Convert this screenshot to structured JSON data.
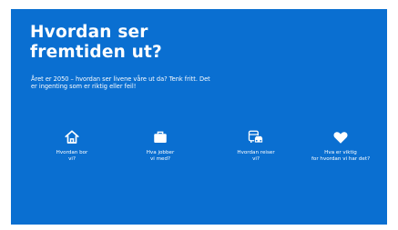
{
  "page": {
    "title_line1": "Hvordan ser",
    "title_line2": "fremtiden ut?",
    "intro": "Året er 2050 – hvordan ser livene våre ut da? Tenk fritt. Det er ingenting som er riktig eller feil!"
  },
  "options": [
    {
      "icon": "home-icon",
      "label": "Hvordan bor\nvi?"
    },
    {
      "icon": "briefcase-icon",
      "label": "Hva jobber\nvi med?"
    },
    {
      "icon": "vehicles-icon",
      "label": "Hvordan reiser\nvi?"
    },
    {
      "icon": "heart-icon",
      "label": "Hva er viktig\nfor hvordan vi har det?"
    }
  ],
  "colors": {
    "background": "#0a6fd1",
    "text": "#ffffff"
  }
}
